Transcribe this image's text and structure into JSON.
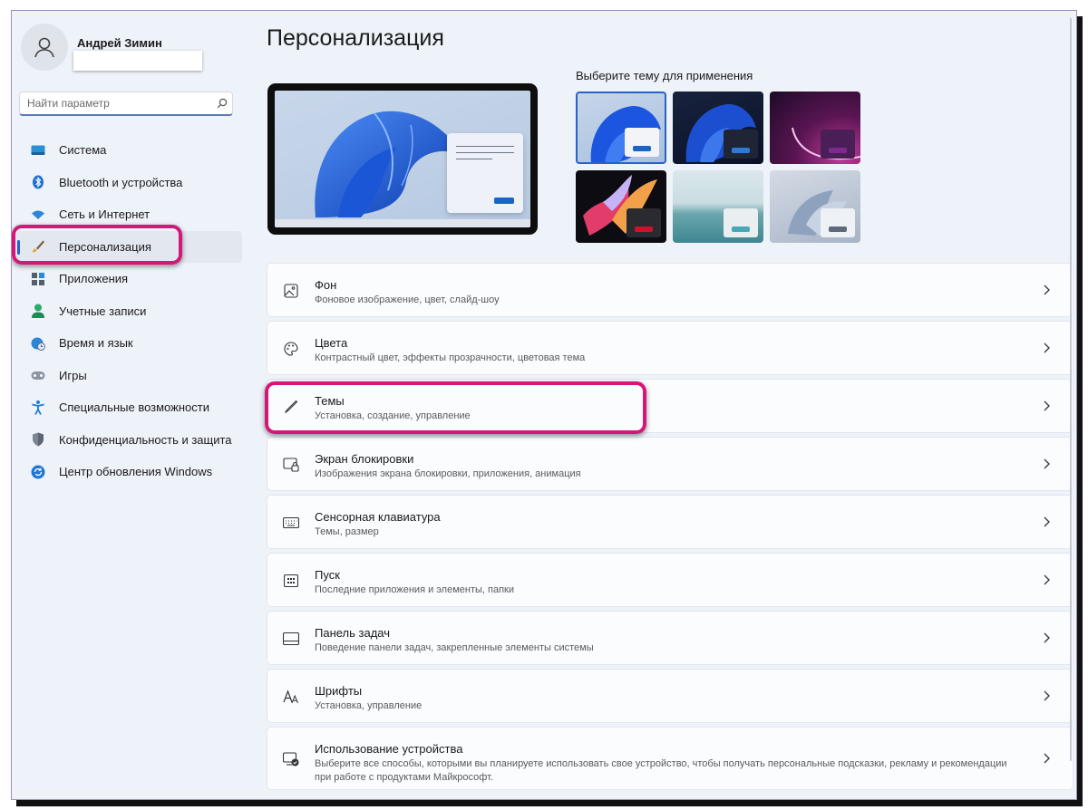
{
  "user": {
    "name": "Андрей Зимин"
  },
  "search": {
    "placeholder": "Найти параметр"
  },
  "sidebar": {
    "items": [
      {
        "label": "Система",
        "icon": "system-icon"
      },
      {
        "label": "Bluetooth и устройства",
        "icon": "bluetooth-icon"
      },
      {
        "label": "Сеть и Интернет",
        "icon": "wifi-icon"
      },
      {
        "label": "Персонализация",
        "icon": "brush-icon",
        "active": true
      },
      {
        "label": "Приложения",
        "icon": "apps-icon"
      },
      {
        "label": "Учетные записи",
        "icon": "account-icon"
      },
      {
        "label": "Время и язык",
        "icon": "globe-clock-icon"
      },
      {
        "label": "Игры",
        "icon": "gamepad-icon"
      },
      {
        "label": "Специальные возможности",
        "icon": "accessibility-icon"
      },
      {
        "label": "Конфиденциальность и защита",
        "icon": "shield-icon"
      },
      {
        "label": "Центр обновления Windows",
        "icon": "update-icon"
      }
    ]
  },
  "main": {
    "title": "Персонализация",
    "theme_prompt": "Выберите тему для применения",
    "cards": [
      {
        "title": "Фон",
        "subtitle": "Фоновое изображение, цвет, слайд-шоу",
        "icon": "image-icon"
      },
      {
        "title": "Цвета",
        "subtitle": "Контрастный цвет, эффекты прозрачности, цветовая тема",
        "icon": "palette-icon"
      },
      {
        "title": "Темы",
        "subtitle": "Установка, создание, управление",
        "icon": "pen-icon"
      },
      {
        "title": "Экран блокировки",
        "subtitle": "Изображения экрана блокировки, приложения, анимация",
        "icon": "lock-screen-icon"
      },
      {
        "title": "Сенсорная клавиатура",
        "subtitle": "Темы, размер",
        "icon": "keyboard-icon"
      },
      {
        "title": "Пуск",
        "subtitle": "Последние приложения и элементы, папки",
        "icon": "start-icon"
      },
      {
        "title": "Панель задач",
        "subtitle": "Поведение панели задач, закрепленные элементы системы",
        "icon": "taskbar-icon"
      },
      {
        "title": "Шрифты",
        "subtitle": "Установка, управление",
        "icon": "fonts-icon"
      },
      {
        "title": "Использование устройства",
        "subtitle": "Выберите все способы, которыми вы планируете использовать свое устройство, чтобы получать персональные подсказки, рекламу и рекомендации при работе с продуктами Майкрософт.",
        "icon": "device-usage-icon"
      }
    ]
  },
  "colors": {
    "accent": "#2962c4",
    "highlight": "#d6177a"
  }
}
